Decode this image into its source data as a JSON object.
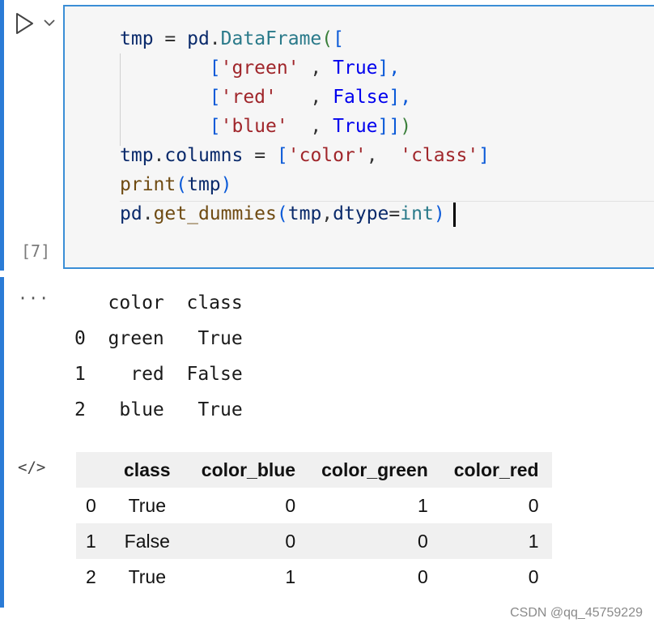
{
  "cell": {
    "execution_count": "[7]",
    "code_lines": [
      [
        {
          "t": "tmp",
          "c": "kw-name"
        },
        {
          "t": " = ",
          "c": "kw-op"
        },
        {
          "t": "pd",
          "c": "kw-name"
        },
        {
          "t": ".",
          "c": "kw-op"
        },
        {
          "t": "DataFrame",
          "c": "kw-cls"
        },
        {
          "t": "(",
          "c": "kw-paren"
        },
        {
          "t": "[",
          "c": "kw-br"
        }
      ],
      [
        {
          "t": "        ",
          "c": "kw-op"
        },
        {
          "t": "[",
          "c": "kw-br"
        },
        {
          "t": "'green'",
          "c": "kw-str"
        },
        {
          "t": " , ",
          "c": "kw-op"
        },
        {
          "t": "True",
          "c": "kw-bool"
        },
        {
          "t": "],",
          "c": "kw-br"
        }
      ],
      [
        {
          "t": "        ",
          "c": "kw-op"
        },
        {
          "t": "[",
          "c": "kw-br"
        },
        {
          "t": "'red'",
          "c": "kw-str"
        },
        {
          "t": "   , ",
          "c": "kw-op"
        },
        {
          "t": "False",
          "c": "kw-bool"
        },
        {
          "t": "],",
          "c": "kw-br"
        }
      ],
      [
        {
          "t": "        ",
          "c": "kw-op"
        },
        {
          "t": "[",
          "c": "kw-br"
        },
        {
          "t": "'blue'",
          "c": "kw-str"
        },
        {
          "t": "  , ",
          "c": "kw-op"
        },
        {
          "t": "True",
          "c": "kw-bool"
        },
        {
          "t": "]]",
          "c": "kw-br"
        },
        {
          "t": ")",
          "c": "kw-paren"
        }
      ],
      [
        {
          "t": "tmp",
          "c": "kw-name"
        },
        {
          "t": ".",
          "c": "kw-op"
        },
        {
          "t": "columns",
          "c": "kw-name"
        },
        {
          "t": " = ",
          "c": "kw-op"
        },
        {
          "t": "[",
          "c": "kw-br"
        },
        {
          "t": "'color'",
          "c": "kw-str"
        },
        {
          "t": ",  ",
          "c": "kw-op"
        },
        {
          "t": "'class'",
          "c": "kw-str"
        },
        {
          "t": "]",
          "c": "kw-br"
        }
      ],
      [
        {
          "t": "print",
          "c": "kw-fn"
        },
        {
          "t": "(",
          "c": "kw-br"
        },
        {
          "t": "tmp",
          "c": "kw-name"
        },
        {
          "t": ")",
          "c": "kw-br"
        }
      ],
      [
        {
          "t": "pd",
          "c": "kw-name"
        },
        {
          "t": ".",
          "c": "kw-op"
        },
        {
          "t": "get_dummies",
          "c": "kw-fn"
        },
        {
          "t": "(",
          "c": "kw-br"
        },
        {
          "t": "tmp",
          "c": "kw-name"
        },
        {
          "t": ",",
          "c": "kw-op"
        },
        {
          "t": "dtype",
          "c": "kw-name"
        },
        {
          "t": "=",
          "c": "kw-op"
        },
        {
          "t": "int",
          "c": "kw-builtin"
        },
        {
          "t": ")",
          "c": "kw-br"
        }
      ]
    ]
  },
  "output": {
    "ellipsis": "···",
    "stdout_lines": [
      "   color  class",
      "0  green   True",
      "1    red  False",
      "2   blue   True"
    ],
    "code_icon": "</>",
    "table": {
      "columns": [
        "",
        "class",
        "color_blue",
        "color_green",
        "color_red"
      ],
      "rows": [
        [
          "0",
          "True",
          "0",
          "1",
          "0"
        ],
        [
          "1",
          "False",
          "0",
          "0",
          "1"
        ],
        [
          "2",
          "True",
          "1",
          "0",
          "0"
        ]
      ]
    }
  },
  "watermark": "CSDN @qq_45759229",
  "icons": {
    "run": "play-triangle-icon",
    "toggle": "chevron-down-icon",
    "output_type": "code-brackets-icon"
  }
}
